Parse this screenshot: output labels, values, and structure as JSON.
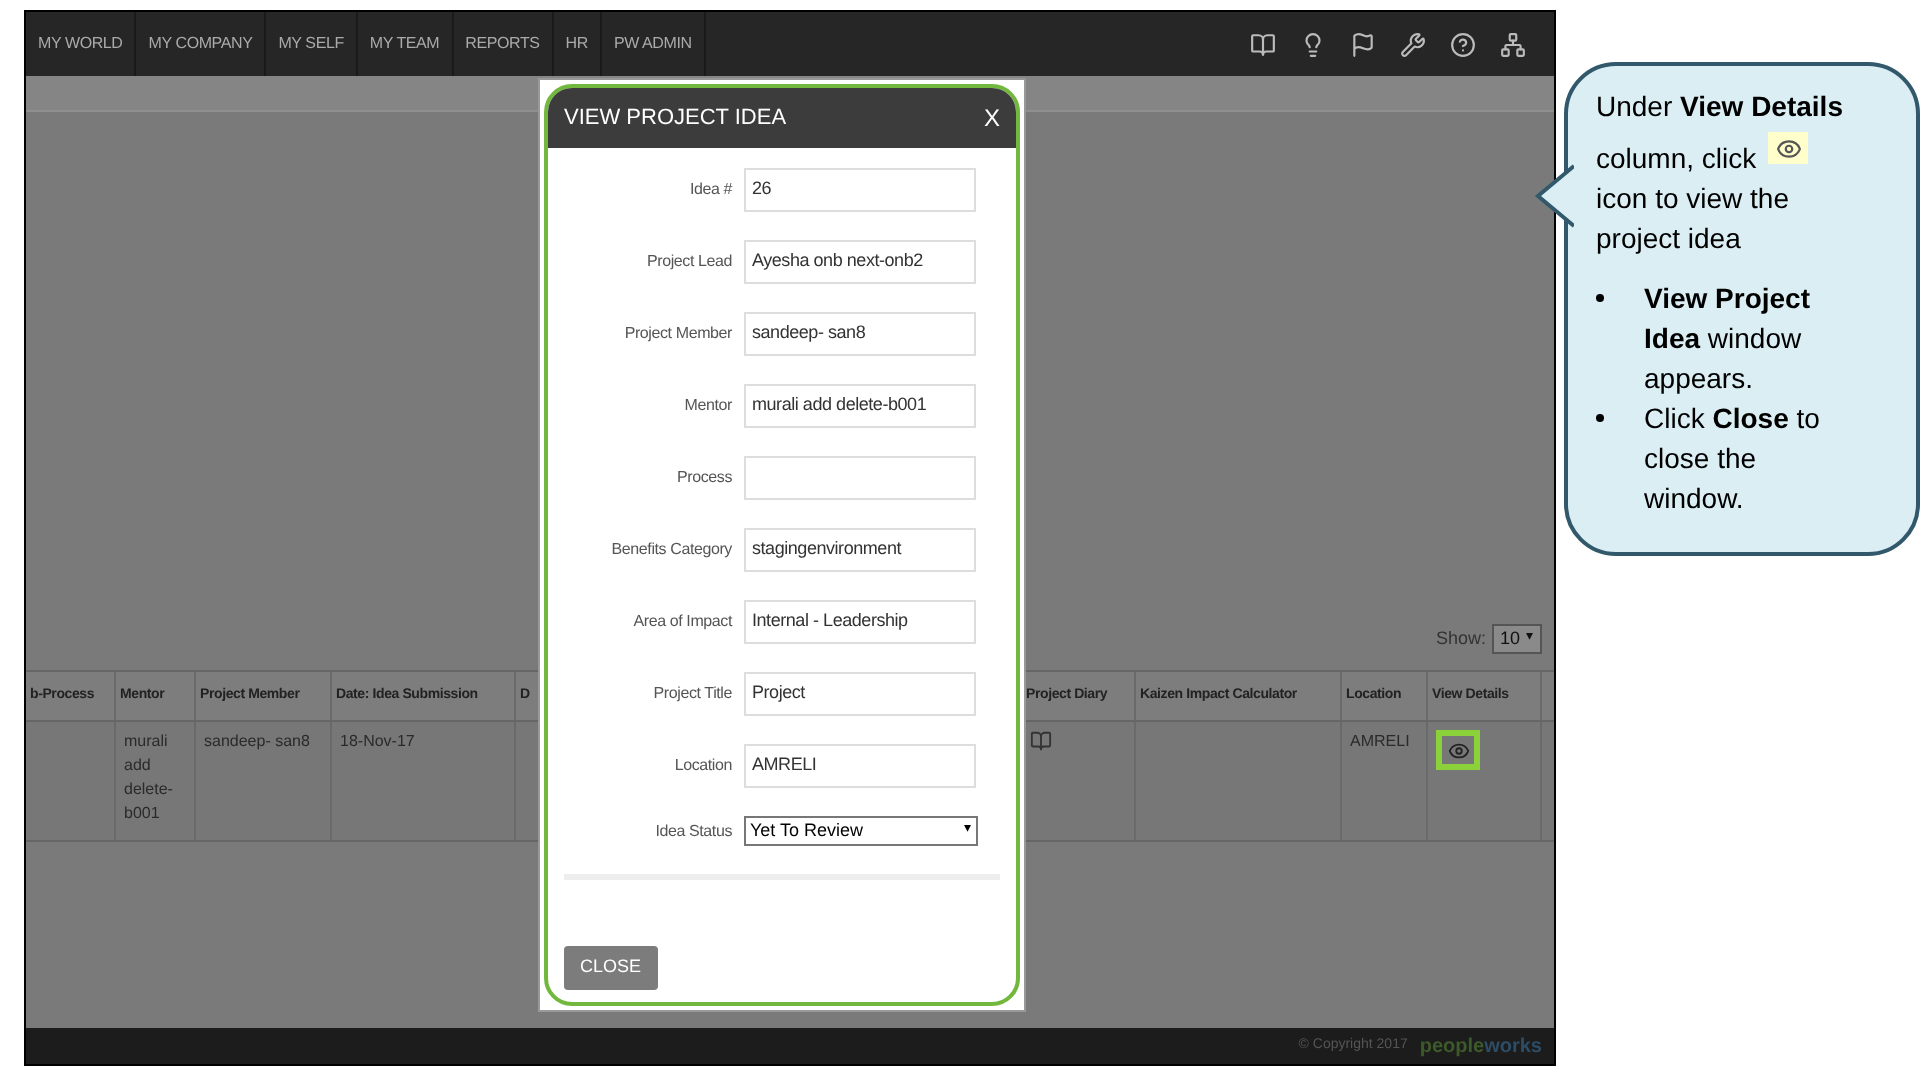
{
  "nav": {
    "items": [
      "MY WORLD",
      "MY COMPANY",
      "MY SELF",
      "MY TEAM",
      "REPORTS",
      "HR",
      "PW ADMIN"
    ]
  },
  "toolbar": {
    "show_label": "Show:",
    "page_size": "10",
    "arrow": "▾"
  },
  "table": {
    "columns": [
      "b-Process",
      "Mentor",
      "Project Member",
      "Date: Idea Submission",
      "D",
      "Project Diary",
      "Kaizen Impact Calculator",
      "Location",
      "View Details"
    ],
    "rows": [
      {
        "cells": [
          {
            "kind": "empty"
          },
          {
            "kind": "text",
            "text": "murali add delete-b001"
          },
          {
            "kind": "text",
            "text": "sandeep- san8"
          },
          {
            "kind": "text",
            "text": "18-Nov-17"
          },
          {
            "kind": "empty"
          },
          {
            "kind": "book"
          },
          {
            "kind": "empty"
          },
          {
            "kind": "text",
            "text": "AMRELI"
          },
          {
            "kind": "view",
            "highlighted": true
          }
        ]
      }
    ]
  },
  "modal": {
    "title": "VIEW PROJECT IDEA",
    "close_glyph": "X",
    "fields": [
      {
        "label": "Idea #",
        "value": "26",
        "kind": "text"
      },
      {
        "label": "Project Lead",
        "value": "Ayesha onb next-onb2",
        "kind": "text"
      },
      {
        "label": "Project Member",
        "value": "sandeep- san8",
        "kind": "text"
      },
      {
        "label": "Mentor",
        "value": "murali add delete-b001",
        "kind": "text"
      },
      {
        "label": "Process",
        "kind": "text"
      },
      {
        "label": "Benefits Category",
        "value": "stagingenvironment",
        "kind": "text"
      },
      {
        "label": "Area of Impact",
        "value": "Internal - Leadership",
        "kind": "text"
      },
      {
        "label": "Project Title",
        "value": "Project",
        "kind": "text"
      },
      {
        "label": "Location",
        "value": "AMRELI",
        "kind": "text"
      },
      {
        "label": "Idea Status",
        "value": "Yet To Review",
        "kind": "select",
        "arrow": "▾"
      }
    ],
    "button": "CLOSE"
  },
  "footer": {
    "copyright": "© Copyright 2017",
    "logo_first": "people",
    "logo_second": "works"
  },
  "callout": {
    "line_1": "Under **View Details**",
    "line_2": "column, click",
    "line_3": "icon to view the project idea",
    "bullets": [
      "**View Project Idea** window appears.",
      "Click **Close** to close the window."
    ]
  }
}
